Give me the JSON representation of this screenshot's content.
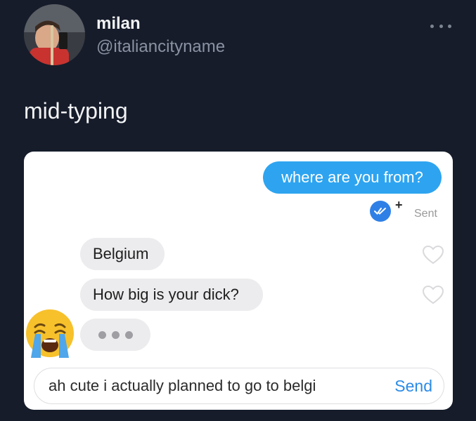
{
  "author": {
    "name": "milan",
    "handle": "@italiancityname"
  },
  "tweet": {
    "text": "mid-typing"
  },
  "chat": {
    "outgoing": [
      {
        "text": "where are you from?",
        "status": "Sent"
      }
    ],
    "incoming": [
      {
        "text": "Belgium"
      },
      {
        "text": "How big is your dick?"
      }
    ],
    "input": {
      "value": "ah cute i actually planned to go to belgi",
      "send_label": "Send"
    }
  },
  "colors": {
    "background": "#161c2a",
    "outgoing_bubble": "#2ea4f0",
    "incoming_bubble": "#ececee",
    "send_link": "#2b8be6",
    "read_check": "#2f80e6"
  },
  "icons": {
    "more": "more-horizontal-icon",
    "read_receipt": "double-check-icon",
    "like": "heart-outline-icon",
    "emoji": "loudly-crying-face-emoji"
  }
}
